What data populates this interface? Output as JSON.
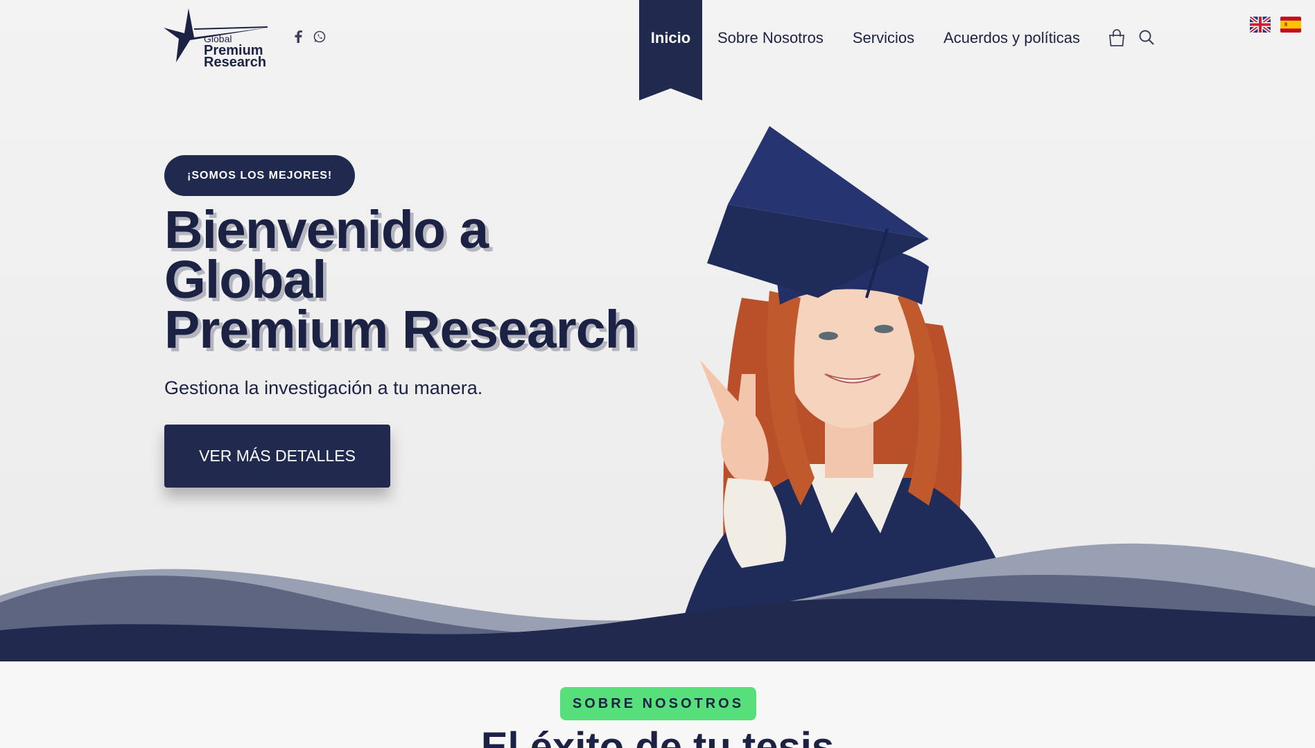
{
  "logo": {
    "line1": "Global",
    "line2": "Premium",
    "line3": "Research"
  },
  "social": {
    "facebook_icon": "facebook-icon",
    "whatsapp_icon": "whatsapp-icon"
  },
  "nav": {
    "items": [
      "Inicio",
      "Sobre Nosotros",
      "Servicios",
      "Acuerdos y políticas"
    ],
    "active": "Inicio"
  },
  "header_icons": {
    "cart": "cart-icon",
    "search": "search-icon"
  },
  "languages": [
    "en-flag",
    "es-flag"
  ],
  "hero": {
    "badge": "¡SOMOS LOS MEJORES!",
    "headline_line1": "Bienvenido a",
    "headline_line2": "Global",
    "headline_line3": "Premium Research",
    "subtitle": "Gestiona la investigación a tu manera.",
    "cta": "VER MÁS DETALLES"
  },
  "about": {
    "pill": "SOBRE NOSOTROS",
    "title": "El éxito de tu tesis"
  },
  "colors": {
    "primary": "#202a4e",
    "accent": "#57e07a",
    "background": "#f0f0f0"
  }
}
